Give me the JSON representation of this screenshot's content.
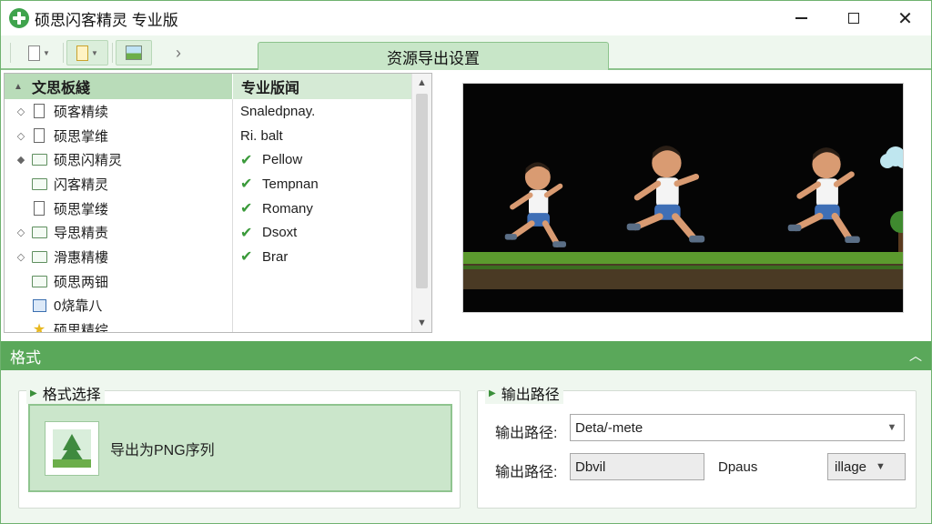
{
  "window": {
    "title": "硕思闪客精灵 专业版",
    "controls": {
      "minimize": "",
      "maximize": "",
      "close": "✕"
    }
  },
  "toolbar": {
    "active_tab": "资源导出设置",
    "next_icon": "chevron-right-icon"
  },
  "tree": {
    "col1_header": "文思板綫",
    "col2_header": "专业版闻",
    "rows": [
      {
        "label": "硕客精续",
        "icon": "file-icon",
        "expander": "◇",
        "col2": "Snaledpnay.",
        "checked": false
      },
      {
        "label": "硕思掌维",
        "icon": "file-icon",
        "expander": "◇",
        "col2": "Ri. balt",
        "checked": false
      },
      {
        "label": "硕思闪精灵",
        "icon": "folder-icon",
        "expander": "◆",
        "col2": "Pellow",
        "checked": true
      },
      {
        "label": "闪客精灵",
        "icon": "folder-icon",
        "expander": "",
        "col2": "Tempnan",
        "checked": true
      },
      {
        "label": "硕思掌缕",
        "icon": "file-icon",
        "expander": "",
        "col2": "Romany",
        "checked": true
      },
      {
        "label": "导思精责",
        "icon": "folder-icon",
        "expander": "◇",
        "col2": "Dsoxt",
        "checked": true
      },
      {
        "label": "滑惠精樓",
        "icon": "folder-icon",
        "expander": "◇",
        "col2": "Brar",
        "checked": true
      },
      {
        "label": "硕思两钿",
        "icon": "folder-icon",
        "expander": "",
        "col2": "",
        "checked": false
      },
      {
        "label": "0烧靠八",
        "icon": "image-icon",
        "expander": "",
        "col2": "",
        "checked": false
      },
      {
        "label": "硕思精综",
        "icon": "star-icon",
        "expander": "",
        "col2": "",
        "checked": false
      }
    ]
  },
  "format": {
    "section_title": "格式",
    "collapse_icon": "chevron-up-icon",
    "group_title": "格式选择",
    "option_label": "导出为PNG序列"
  },
  "output": {
    "group_title": "输出路径",
    "path_label": "输出路径:",
    "path_value": "Deta/-mete",
    "path2_label": "输出路径:",
    "path2_value": "Dbvil",
    "aux_text": "Dpaus",
    "image_dropdown": "illage"
  },
  "colors": {
    "accent": "#5aa85a",
    "tab_active": "#c8e6c8",
    "check": "#3a9a3a"
  }
}
